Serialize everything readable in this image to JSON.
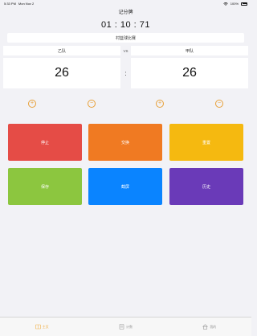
{
  "status_bar": {
    "time": "5:33 PM",
    "date": "Mon Nov 2",
    "battery": "100%"
  },
  "nav": {
    "title": "记分牌"
  },
  "timer": "01 : 10 : 71",
  "match_name": "村篮球比赛",
  "teams": {
    "a": {
      "name": "乙队",
      "score": "26"
    },
    "b": {
      "name": "甲队",
      "score": "26"
    },
    "vs": "VS",
    "separator": ":"
  },
  "score_buttons": {
    "plus": "+",
    "minus": "−"
  },
  "actions": [
    {
      "label": "停止",
      "color": "#e54c46"
    },
    {
      "label": "交换",
      "color": "#f07a22"
    },
    {
      "label": "重置",
      "color": "#f5b910"
    },
    {
      "label": "保存",
      "color": "#8cc63f"
    },
    {
      "label": "截屏",
      "color": "#0a84ff"
    },
    {
      "label": "历史",
      "color": "#6a3ab8"
    }
  ],
  "tabs": [
    {
      "label": "主页",
      "icon": "scoreboard-icon",
      "active": true
    },
    {
      "label": "计数",
      "icon": "counter-icon",
      "active": false
    },
    {
      "label": "我的",
      "icon": "home-icon",
      "active": false
    }
  ],
  "colors": {
    "accent": "#f1b14a",
    "background": "#f2f2f6"
  }
}
